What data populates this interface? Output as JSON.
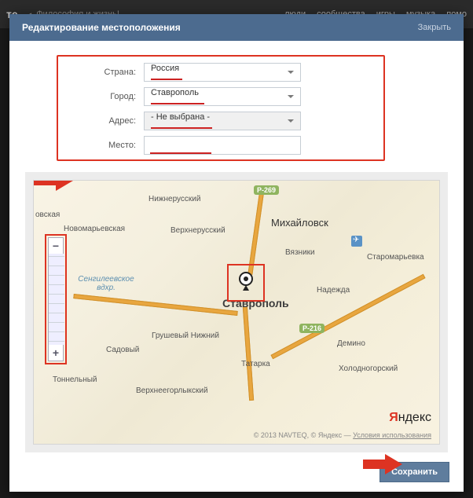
{
  "bg_nav": {
    "logo": "те",
    "back": "◂",
    "section": "Философия и жизнь!",
    "items": [
      "люди",
      "сообщества",
      "игры",
      "музыка",
      "помо"
    ]
  },
  "modal": {
    "title": "Редактирование местоположения",
    "close": "Закрыть"
  },
  "form": {
    "country": {
      "label": "Страна:",
      "value": "Россия"
    },
    "city": {
      "label": "Город:",
      "value": "Ставрополь"
    },
    "address": {
      "label": "Адрес:",
      "value": "- Не выбрана -"
    },
    "place": {
      "label": "Место:",
      "value": ""
    }
  },
  "map": {
    "center_city": "Ставрополь",
    "labels": {
      "nizhnerussky": "Нижнерусский",
      "novomaryevskaya": "Новомарьевская",
      "verkhnerussky": "Верхнерусский",
      "mikhaylovsk": "Михайловск",
      "ovskaya": "овская",
      "vyazniki": "Вязники",
      "staromaryevka": "Старомарьевка",
      "sengileevskoe": "Сенгилеевское вдхр.",
      "nadezhda": "Надежда",
      "grushevy": "Грушевый Нижний",
      "sadovy": "Садовый",
      "demino": "Демино",
      "tatarka": "Татарка",
      "tonnelny": "Тоннельный",
      "kholodnogorsky": "Холодногорский",
      "verkhneegorlyksky": "Верхнеегорлыкский"
    },
    "roads": {
      "r269": "Р-269",
      "r216": "Р-216"
    },
    "brand": {
      "y1": "Я",
      "y2": "ндекс"
    },
    "attribution": "© 2013 NAVTEQ, © Яндекс — ",
    "terms": "Условия использования"
  },
  "zoom": {
    "in": "+",
    "out": "−"
  },
  "footer": {
    "save": "Сохранить"
  }
}
